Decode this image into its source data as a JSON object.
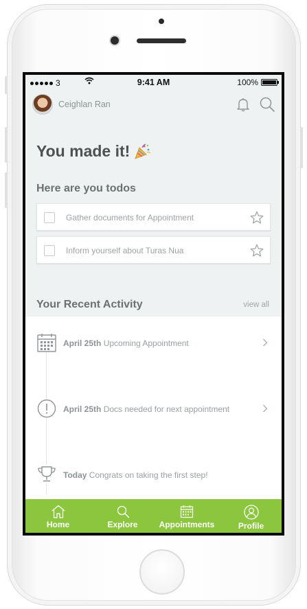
{
  "status_bar": {
    "carrier": "3",
    "time": "9:41 AM",
    "battery_percent": "100%",
    "battery_level": 1.0
  },
  "header": {
    "user_name": "Ceighlan Ran",
    "icons": [
      "bell-icon",
      "search-icon"
    ]
  },
  "hero": {
    "title": "You made it!",
    "icon": "party-popper-icon"
  },
  "todos": {
    "heading": "Here are you todos",
    "items": [
      {
        "label": "Gather documents for Appointment",
        "checked": false,
        "starred": false
      },
      {
        "label": "Inform yourself about Turas Nua",
        "checked": false,
        "starred": false
      }
    ]
  },
  "activity": {
    "heading": "Your Recent Activity",
    "view_all": "view all",
    "items": [
      {
        "date": "April 25th",
        "text": "Upcoming Appointment",
        "icon": "calendar-icon",
        "has_chevron": true
      },
      {
        "date": "April 25th",
        "text": "Docs needed for next appointment",
        "icon": "alert-circle-icon",
        "has_chevron": true
      },
      {
        "date": "Today",
        "text": "Congrats on taking the first step!",
        "icon": "trophy-icon",
        "has_chevron": false
      }
    ]
  },
  "tab_bar": {
    "accent_color": "#8cc63f",
    "tabs": [
      {
        "label": "Home",
        "icon": "home-icon"
      },
      {
        "label": "Explore",
        "icon": "search-icon"
      },
      {
        "label": "Appointments",
        "icon": "calendar-icon"
      },
      {
        "label": "Profile",
        "icon": "profile-icon"
      }
    ]
  }
}
